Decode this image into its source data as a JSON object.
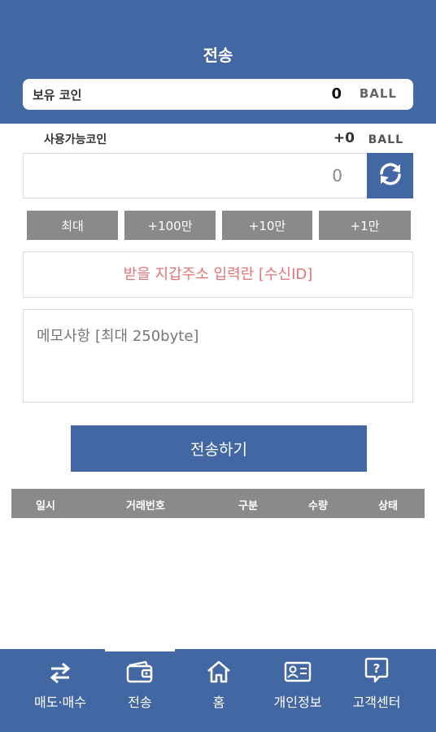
{
  "header": {
    "title": "전송"
  },
  "held": {
    "label": "보유 코인",
    "value": "0",
    "unit": "BALL"
  },
  "available": {
    "label": "사용가능코인",
    "value": "+0",
    "unit": "BALL"
  },
  "amount": {
    "value": "0",
    "placeholder": "0"
  },
  "quick_buttons": [
    "최대",
    "+100만",
    "+10만",
    "+1만"
  ],
  "address": {
    "placeholder": "받을 지갑주소 입력란 [수신ID]"
  },
  "memo": {
    "placeholder": "메모사항 [최대 250byte]"
  },
  "send_button": "전송하기",
  "table": {
    "headers": [
      "일시",
      "거래번호",
      "구분",
      "수량",
      "상태"
    ],
    "rows": []
  },
  "tabs": [
    {
      "label": "매도·매수",
      "icon": "swap-arrows-icon"
    },
    {
      "label": "전송",
      "icon": "wallet-icon",
      "active": true
    },
    {
      "label": "홈",
      "icon": "home-icon"
    },
    {
      "label": "개인정보",
      "icon": "id-card-icon"
    },
    {
      "label": "고객센터",
      "icon": "help-bubble-icon"
    }
  ],
  "colors": {
    "primary": "#4367a2",
    "button_gray": "#8a8a8a",
    "placeholder_red": "#e57373"
  }
}
